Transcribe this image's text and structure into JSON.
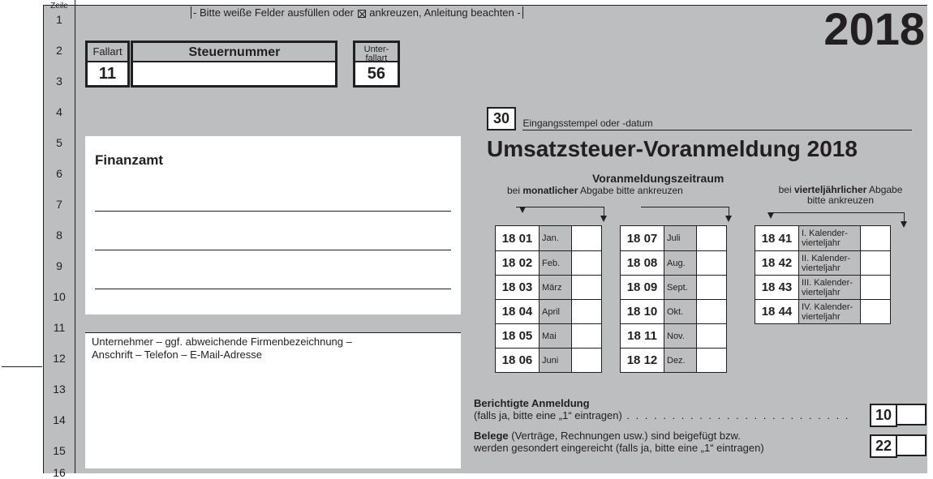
{
  "zeile_header": "Zeile",
  "line_numbers": [
    "1",
    "2",
    "3",
    "4",
    "5",
    "6",
    "7",
    "8",
    "9",
    "10",
    "11",
    "12",
    "13",
    "14",
    "15",
    "16"
  ],
  "top_instruction_a": "- Bitte weiße Felder ausfüllen oder",
  "top_instruction_b": "ankreuzen, Anleitung beachten -",
  "year": "2018",
  "fallart_label": "Fallart",
  "fallart_value": "11",
  "steuernr_label": "Steuernummer",
  "steuernr_value": "",
  "unterfallart_label_a": "Unter-",
  "unterfallart_label_b": "fallart",
  "unterfallart_value": "56",
  "code30": "30",
  "code30_label": "Eingangsstempel oder -datum",
  "main_title": "Umsatzsteuer-Voranmeldung 2018",
  "vz_heading": "Voranmeldungszeitraum",
  "vz_monat_a": "bei ",
  "vz_monat_b": "monatlicher",
  "vz_monat_c": " Abgabe bitte ankreuzen",
  "vz_quart_a": "bei ",
  "vz_quart_b": "vierteljährlicher",
  "vz_quart_c": " Abgabe",
  "vz_quart_d": "bitte ankreuzen",
  "months_left": [
    {
      "code": "18 01",
      "name": "Jan."
    },
    {
      "code": "18 02",
      "name": "Feb."
    },
    {
      "code": "18 03",
      "name": "März"
    },
    {
      "code": "18 04",
      "name": "April"
    },
    {
      "code": "18 05",
      "name": "Mai"
    },
    {
      "code": "18 06",
      "name": "Juni"
    }
  ],
  "months_right": [
    {
      "code": "18 07",
      "name": "Juli"
    },
    {
      "code": "18 08",
      "name": "Aug."
    },
    {
      "code": "18 09",
      "name": "Sept."
    },
    {
      "code": "18 10",
      "name": "Okt."
    },
    {
      "code": "18 11",
      "name": "Nov."
    },
    {
      "code": "18 12",
      "name": "Dez."
    }
  ],
  "quarters": [
    {
      "code": "18 41",
      "name": "I. Kalender-\nvierteljahr"
    },
    {
      "code": "18 42",
      "name": "II. Kalender-\nvierteljahr"
    },
    {
      "code": "18 43",
      "name": "III. Kalender-\nvierteljahr"
    },
    {
      "code": "18 44",
      "name": "IV. Kalender-\nvierteljahr"
    }
  ],
  "finanzamt_label": "Finanzamt",
  "unternehmer_a": "Unternehmer – ggf. abweichende Firmenbezeichnung –",
  "unternehmer_b": "Anschrift – Telefon – E-Mail-Adresse",
  "ber_heading": "Berichtigte Anmeldung",
  "ber_sub": "(falls ja, bitte eine „1“ eintragen)",
  "ber_dots": " . . . . . . . . . . . . . . . . . . . . . . . . .",
  "ber_code": "10",
  "belege_a": "Belege",
  "belege_b": " (Verträge, Rechnungen usw.) sind beigefügt bzw.",
  "belege_c": "werden gesondert eingereicht (falls ja, bitte eine „1“ eintragen)",
  "belege_code": "22"
}
